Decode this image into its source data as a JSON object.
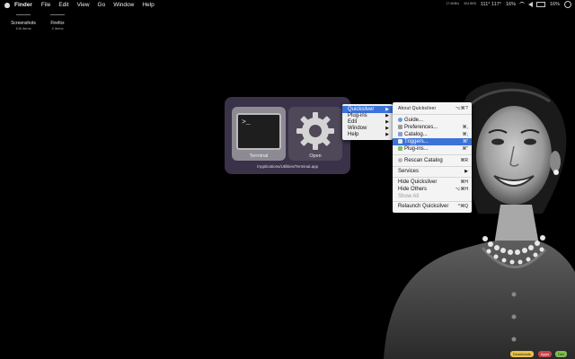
{
  "menubar": {
    "app": "Finder",
    "items": [
      "File",
      "Edit",
      "View",
      "Go",
      "Window",
      "Help"
    ],
    "tray": {
      "stats1": "17.6KB/s",
      "stats2": "304.8KB",
      "temps": "111° 117°",
      "cpu": "16%",
      "battery": "16%"
    }
  },
  "desktop": {
    "items": [
      {
        "label": "Screenshots",
        "sub": "106 items"
      },
      {
        "label": "Firefox",
        "sub": "4 items"
      }
    ]
  },
  "quicksilver": {
    "selected_label": "Terminal",
    "action_label": "Open",
    "path": "/Applications/Utilities/Terminal.app",
    "prompt": ">_"
  },
  "menu1": {
    "items": [
      "Quicksilver",
      "Plug-ins",
      "Edit",
      "Window",
      "Help"
    ]
  },
  "menu2": {
    "about": "About Quicksilver",
    "about_sc": "⌥⌘?",
    "guide": "Guide...",
    "prefs": "Preferences...",
    "prefs_sc": "⌘,",
    "catalog": "Catalog...",
    "catalog_sc": "⌘;",
    "triggers": "Triggers...",
    "triggers_sc": "⌘'",
    "plugins": "Plug-ins...",
    "plugins_sc": "⌘\"",
    "rescan": "Rescan Catalog",
    "rescan_sc": "⌘R",
    "services": "Services",
    "hide": "Hide Quicksilver",
    "hide_sc": "⌘H",
    "hide_others": "Hide Others",
    "hide_others_sc": "⌥⌘H",
    "show_all": "Show All",
    "relaunch": "Relaunch Quicksilver",
    "relaunch_sc": "^⌘Q"
  },
  "dock": {
    "stacks": [
      {
        "label": "Downloads",
        "color": "#e8c14a"
      },
      {
        "label": "Apps",
        "color": "#c9444a"
      },
      {
        "label": "Dev",
        "color": "#7cc04a"
      }
    ]
  }
}
